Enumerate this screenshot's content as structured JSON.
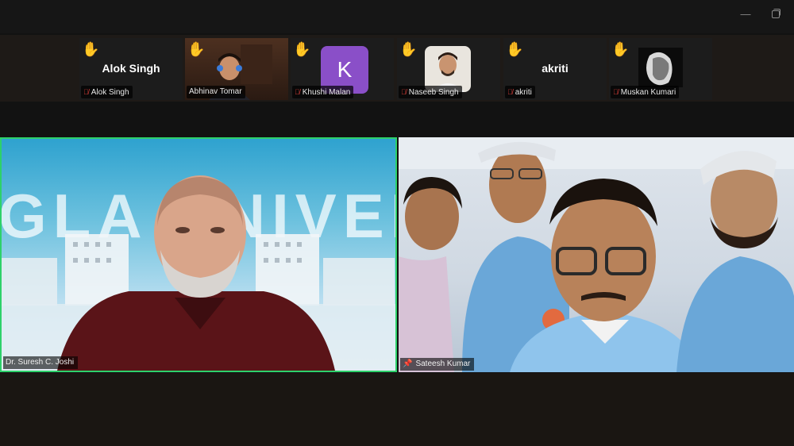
{
  "window": {
    "minimize_icon": "minimize-icon",
    "restore_icon": "restore-icon"
  },
  "gallery": [
    {
      "display": "Alok Singh",
      "label": "Alok Singh",
      "raised_hand": true,
      "muted": true,
      "type": "name"
    },
    {
      "display": "",
      "label": "Abhinav Tomar",
      "raised_hand": true,
      "muted": false,
      "type": "video"
    },
    {
      "display": "K",
      "label": "Khushi Malan",
      "raised_hand": true,
      "muted": true,
      "type": "avatar"
    },
    {
      "display": "",
      "label": "Naseeb Singh",
      "raised_hand": true,
      "muted": true,
      "type": "photo"
    },
    {
      "display": "akriti",
      "label": "akriti",
      "raised_hand": true,
      "muted": true,
      "type": "name"
    },
    {
      "display": "",
      "label": "Muskan Kumari",
      "raised_hand": true,
      "muted": true,
      "type": "photo"
    }
  ],
  "main": {
    "left": {
      "name": "Dr. Suresh C. Joshi",
      "background_text": "GLA UNIVERSITY",
      "active_speaker": true
    },
    "right": {
      "name": "Sateesh Kumar",
      "pinned": true
    }
  },
  "colors": {
    "active_speaker_border": "#2ed16a",
    "muted_icon": "#e0413b",
    "hand_icon": "#f6c343",
    "avatar_k": "#8a4fc8"
  }
}
